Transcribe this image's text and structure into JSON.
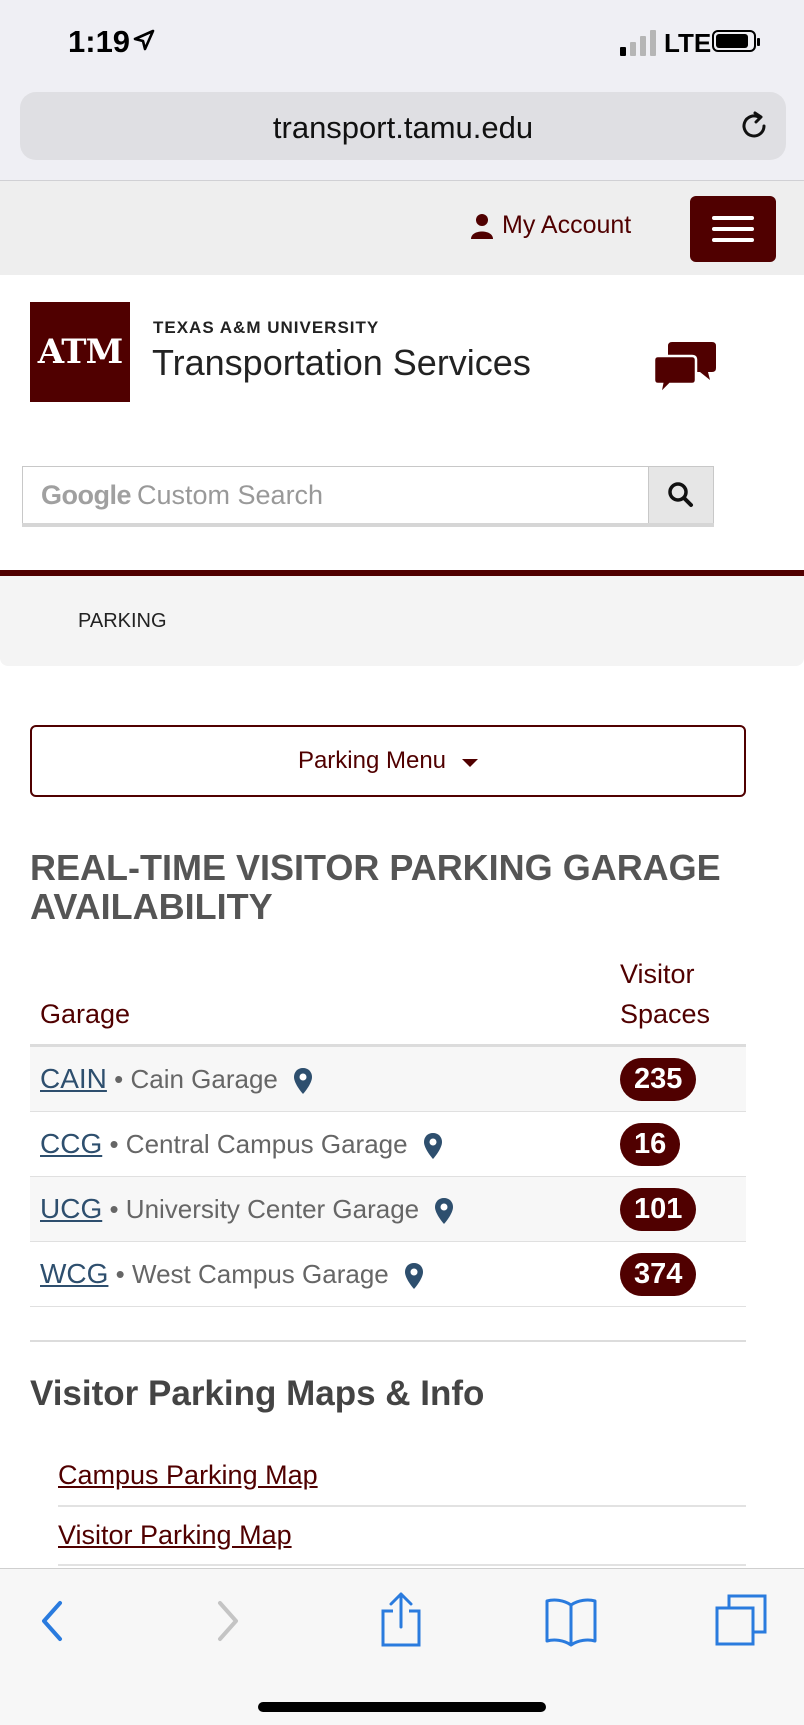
{
  "status_bar": {
    "time": "1:19",
    "network": "LTE"
  },
  "browser": {
    "url": "transport.tamu.edu"
  },
  "site_header": {
    "account_label": "My Account",
    "logo_text": "ATM",
    "university": "TEXAS A&M UNIVERSITY",
    "department": "Transportation Services"
  },
  "search": {
    "brand": "Google",
    "placeholder": "Custom Search"
  },
  "breadcrumb": {
    "label": "PARKING"
  },
  "parking_menu": {
    "label": "Parking Menu"
  },
  "availability": {
    "title": "REAL-TIME VISITOR PARKING GARAGE AVAILABILITY",
    "columns": {
      "garage": "Garage",
      "spaces": "Visitor Spaces"
    },
    "rows": [
      {
        "code": "CAIN",
        "name": "Cain Garage",
        "spaces": "235"
      },
      {
        "code": "CCG",
        "name": "Central Campus Garage",
        "spaces": "16"
      },
      {
        "code": "UCG",
        "name": "University Center Garage",
        "spaces": "101"
      },
      {
        "code": "WCG",
        "name": "West Campus Garage",
        "spaces": "374"
      }
    ]
  },
  "maps_info": {
    "heading": "Visitor Parking Maps & Info",
    "links": [
      "Campus Parking Map",
      "Visitor Parking Map"
    ]
  },
  "colors": {
    "maroon": "#500000",
    "link_blue": "#2e4f6e"
  }
}
